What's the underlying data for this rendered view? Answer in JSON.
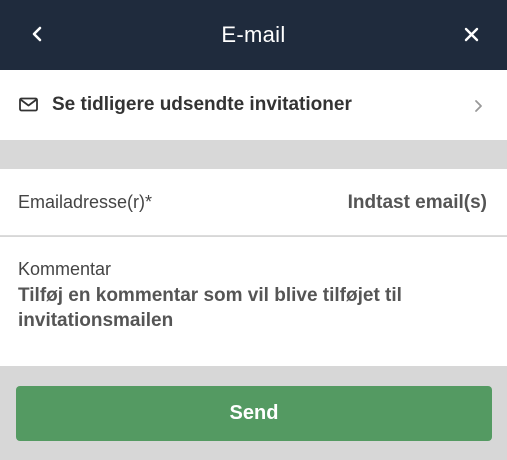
{
  "header": {
    "title": "E-mail",
    "back_icon": "chevron-left-icon",
    "close_icon": "close-icon"
  },
  "invitations": {
    "label": "Se tidligere udsendte invitationer",
    "icon": "envelope-icon",
    "arrow_icon": "chevron-right-icon"
  },
  "email": {
    "label": "Emailadresse(r)*",
    "value": "",
    "placeholder": "Indtast email(s)"
  },
  "comment": {
    "label": "Kommentar",
    "value": "",
    "placeholder": "Tilføj en kommentar som vil blive tilføjet til invitationsmailen"
  },
  "actions": {
    "send_label": "Send"
  },
  "colors": {
    "header_bg": "#1f2b3d",
    "send_button": "#549a62",
    "page_bg": "#d7d7d7"
  }
}
